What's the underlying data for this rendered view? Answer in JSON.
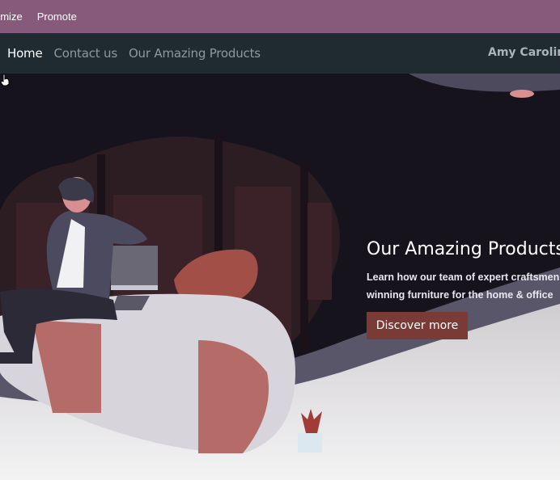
{
  "topbar": {
    "items": [
      {
        "label": "omize"
      },
      {
        "label": "Promote"
      }
    ]
  },
  "navbar": {
    "links": [
      {
        "label": "Home"
      },
      {
        "label": "Contact us"
      },
      {
        "label": "Our Amazing Products"
      }
    ],
    "user": "Amy Caroline"
  },
  "hero": {
    "title": "Our Amazing Products",
    "subtitle_lines": [
      "Learn how our team of expert craftsmen",
      "winning furniture for the home & office"
    ],
    "button_label": "Discover more"
  },
  "colors": {
    "topbar": "#875a7b",
    "navbar": "#1f2b30",
    "hero_dark": "#16131d",
    "button": "#7a3a36"
  }
}
